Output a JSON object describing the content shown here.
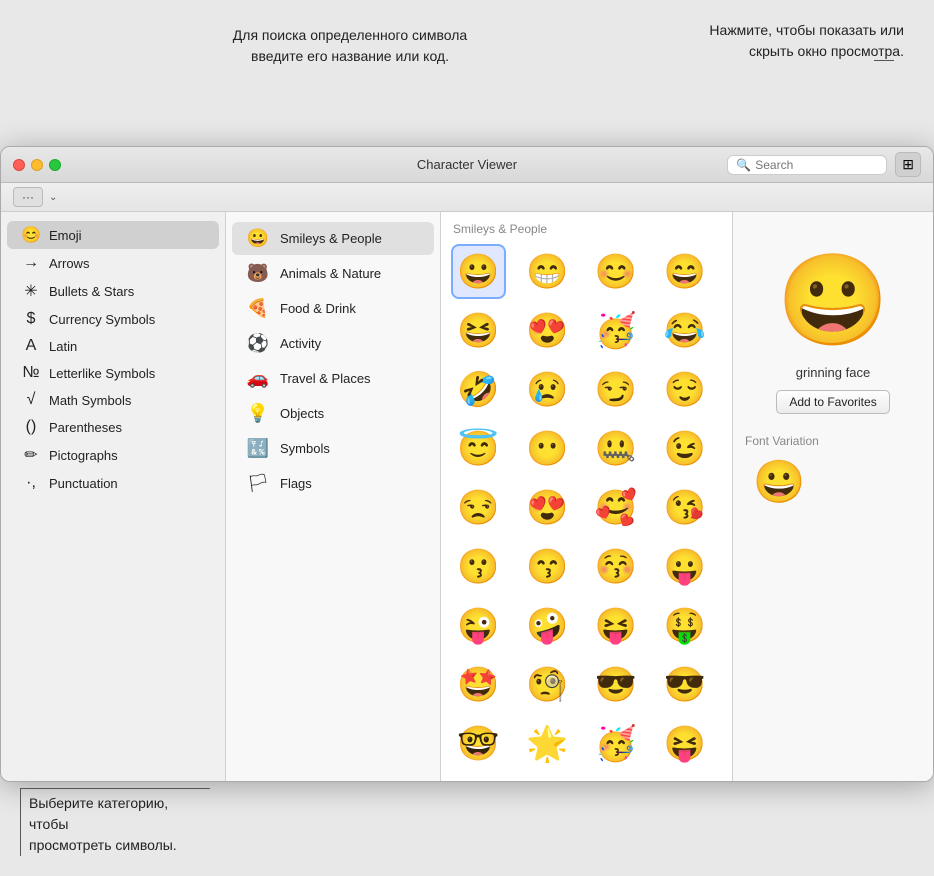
{
  "annotations": {
    "top_right_line1": "Нажмите, чтобы показать или",
    "top_right_line2": "скрыть окно просмотра.",
    "top_center_line1": "Для поиска определенного символа",
    "top_center_line2": "введите его название или код.",
    "bottom_left_line1": "Выберите категорию, чтобы",
    "bottom_left_line2": "просмотреть символы."
  },
  "window": {
    "title": "Character Viewer"
  },
  "toolbar": {
    "more_btn": "···",
    "chevron": "⌄"
  },
  "search": {
    "placeholder": "Search"
  },
  "left_sidebar": {
    "items": [
      {
        "id": "emoji",
        "icon": "😊",
        "label": "Emoji",
        "active": true
      },
      {
        "id": "arrows",
        "icon": "→",
        "label": "Arrows",
        "active": false
      },
      {
        "id": "bullets",
        "icon": "✳",
        "label": "Bullets & Stars",
        "active": false
      },
      {
        "id": "currency",
        "icon": "$",
        "label": "Currency Symbols",
        "active": false
      },
      {
        "id": "latin",
        "icon": "A",
        "label": "Latin",
        "active": false
      },
      {
        "id": "letterlike",
        "icon": "№",
        "label": "Letterlike Symbols",
        "active": false
      },
      {
        "id": "math",
        "icon": "√",
        "label": "Math Symbols",
        "active": false
      },
      {
        "id": "parens",
        "icon": "()",
        "label": "Parentheses",
        "active": false
      },
      {
        "id": "picto",
        "icon": "✏",
        "label": "Pictographs",
        "active": false
      },
      {
        "id": "punct",
        "icon": "·,",
        "label": "Punctuation",
        "active": false
      }
    ]
  },
  "middle_sidebar": {
    "items": [
      {
        "id": "smileys",
        "icon": "😀",
        "label": "Smileys & People",
        "active": true
      },
      {
        "id": "animals",
        "icon": "🐻",
        "label": "Animals & Nature",
        "active": false
      },
      {
        "id": "food",
        "icon": "🍕",
        "label": "Food & Drink",
        "active": false
      },
      {
        "id": "activity",
        "icon": "⚽",
        "label": "Activity",
        "active": false
      },
      {
        "id": "travel",
        "icon": "🚗",
        "label": "Travel & Places",
        "active": false
      },
      {
        "id": "objects",
        "icon": "💡",
        "label": "Objects",
        "active": false
      },
      {
        "id": "symbols",
        "icon": "🔣",
        "label": "Symbols",
        "active": false
      },
      {
        "id": "flags",
        "icon": "🏳",
        "label": "Flags",
        "active": false
      }
    ]
  },
  "emoji_grid": {
    "section_title": "Smileys & People",
    "emojis": [
      "😀",
      "😁",
      "😊",
      "😄",
      "😆",
      "😍",
      "🥳",
      "😂",
      "🤣",
      "😢",
      "😏",
      "😌",
      "😇",
      "😶",
      "🤐",
      "😉",
      "😒",
      "😍",
      "🥰",
      "😘",
      "😗",
      "😙",
      "😚",
      "😛",
      "😜",
      "🤪",
      "😝",
      "🤑",
      "🤩",
      "🧐",
      "😎",
      "😎",
      "🤓",
      "🌟",
      "🥳",
      "😝"
    ]
  },
  "right_panel": {
    "preview_emoji": "😀",
    "emoji_name": "grinning face",
    "add_favorites_label": "Add to Favorites",
    "font_variation_title": "Font Variation",
    "font_variation_emoji": "😀"
  }
}
